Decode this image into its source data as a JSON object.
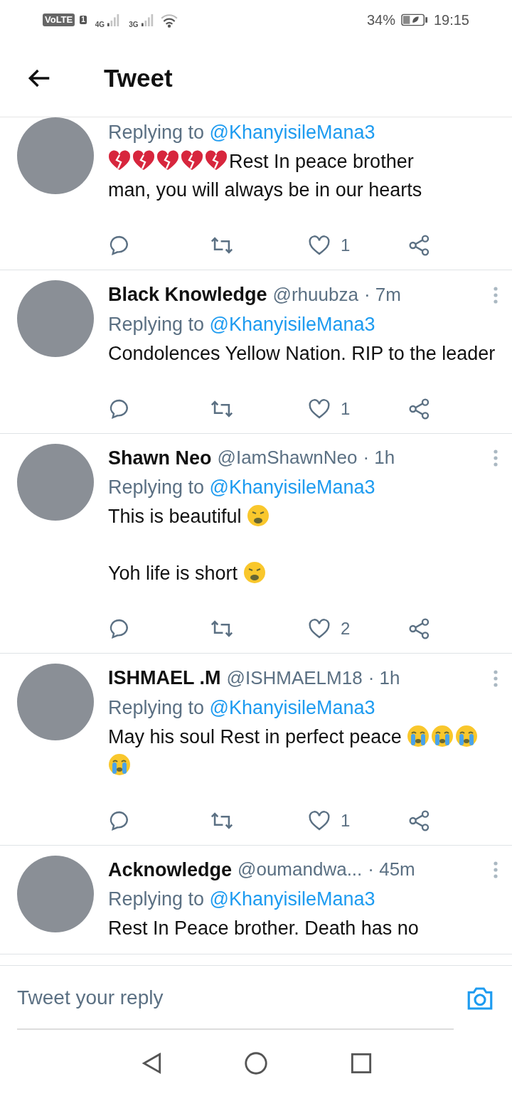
{
  "status_bar": {
    "volte": "VoLTE",
    "sim": "1",
    "network_1": "4G",
    "network_2": "3G",
    "battery": "34%",
    "time": "19:15"
  },
  "header": {
    "title": "Tweet"
  },
  "tweets": [
    {
      "replying_label": "Replying to",
      "reply_handle": "@KhanyisileMana3",
      "body": [
        [
          {
            "kind": "broken_heart"
          },
          {
            "kind": "broken_heart"
          },
          {
            "kind": "broken_heart"
          },
          {
            "kind": "broken_heart"
          },
          {
            "kind": "broken_heart"
          },
          {
            "kind": "text",
            "text": "Rest In peace brother"
          },
          {
            "kind": "line_break"
          },
          {
            "kind": "text",
            "text": "man, you will always be in our hearts"
          }
        ]
      ],
      "likes": "1"
    },
    {
      "author": "Black Knowledge",
      "handle": "@rhuubza",
      "time": "· 7m",
      "replying_label": "Replying to",
      "reply_handle": "@KhanyisileMana3",
      "body": [
        [
          {
            "kind": "text",
            "text": "Condolences Yellow Nation. RIP to the leader"
          }
        ]
      ],
      "likes": "1"
    },
    {
      "author": "Shawn Neo",
      "handle": "@IamShawnNeo",
      "time": "· 1h",
      "replying_label": "Replying to",
      "reply_handle": "@KhanyisileMana3",
      "body": [
        [
          {
            "kind": "text",
            "text": "This is beautiful"
          },
          {
            "kind": "weary"
          }
        ],
        [
          {
            "kind": "text",
            "text": "Yoh life is short"
          },
          {
            "kind": "weary"
          }
        ]
      ],
      "likes": "2"
    },
    {
      "author": "ISHMAEL .M",
      "handle": "@ISHMAELM18",
      "time": "· 1h",
      "replying_label": "Replying to",
      "reply_handle": "@KhanyisileMana3",
      "body": [
        [
          {
            "kind": "text",
            "text": "May his soul Rest in perfect peace"
          },
          {
            "kind": "crying"
          },
          {
            "kind": "crying"
          },
          {
            "kind": "crying"
          },
          {
            "kind": "crying"
          }
        ]
      ],
      "likes": "1"
    },
    {
      "author": "Acknowledge",
      "handle": "@oumandwa...",
      "time": "· 45m",
      "replying_label": "Replying to",
      "reply_handle": "@KhanyisileMana3",
      "body": [
        [
          {
            "kind": "text",
            "text": "Rest In Peace brother.  Death has no"
          }
        ]
      ]
    }
  ],
  "reply_bar": {
    "placeholder": "Tweet your reply"
  }
}
